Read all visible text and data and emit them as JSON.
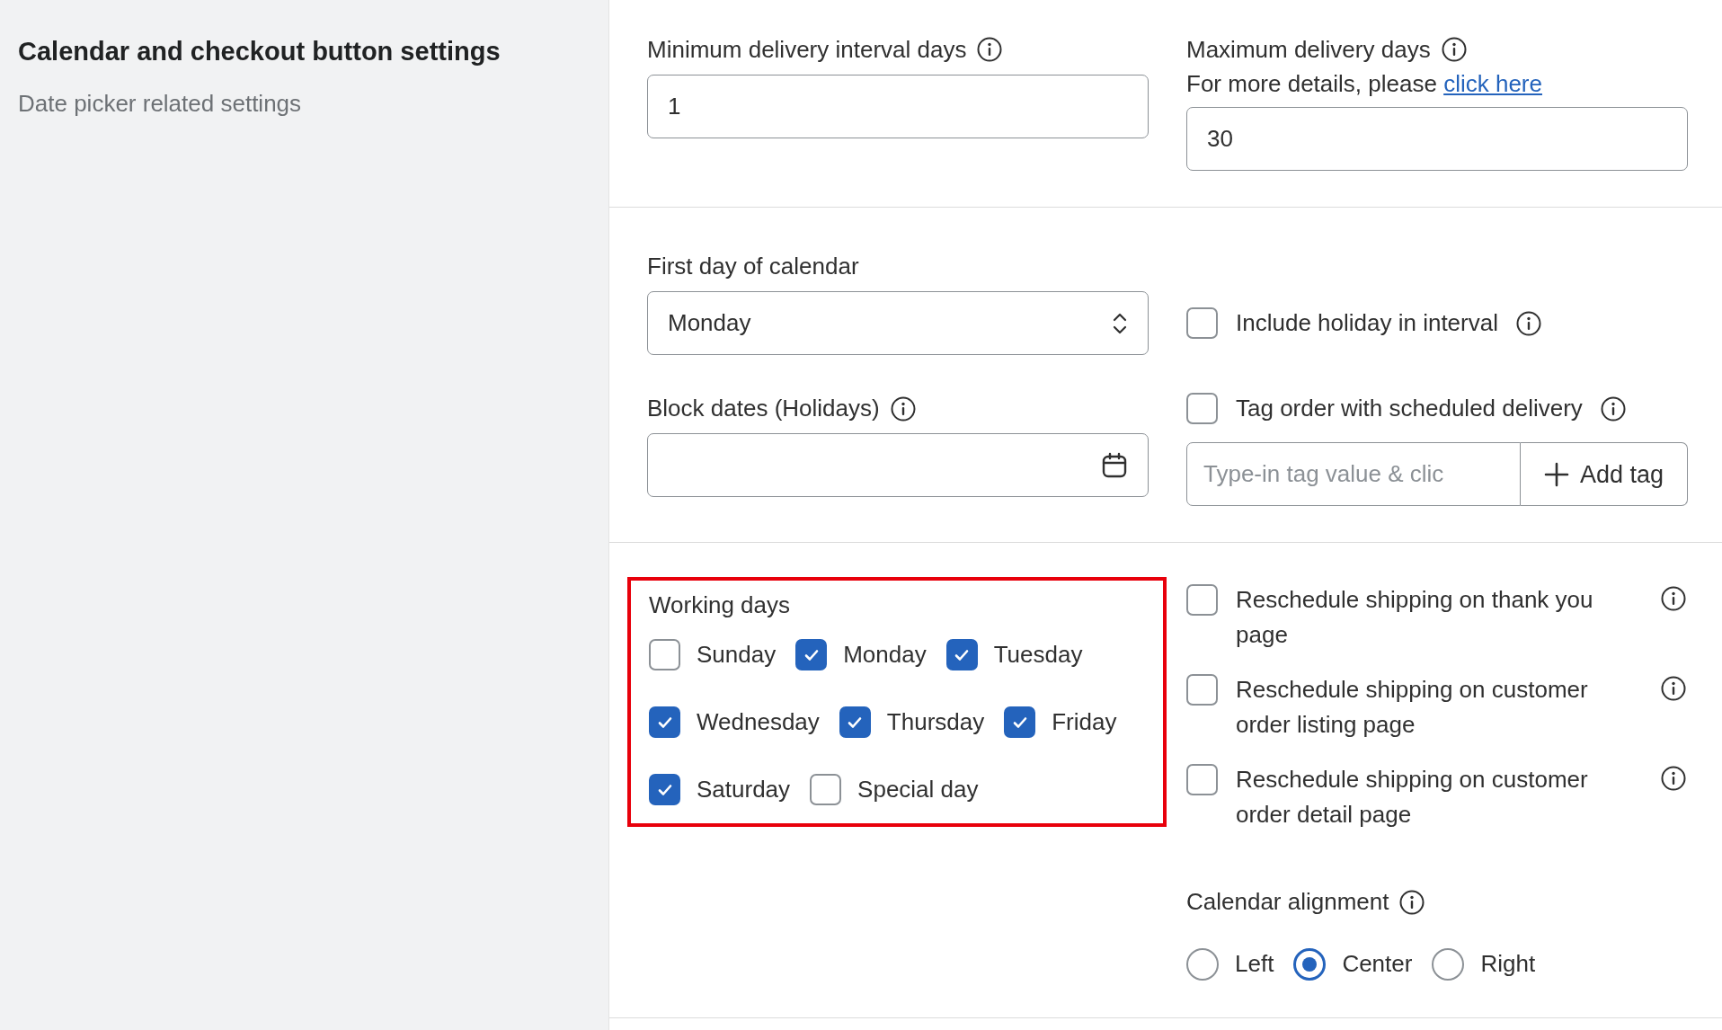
{
  "sidebar": {
    "title": "Calendar and checkout button settings",
    "subtitle": "Date picker related settings"
  },
  "delivery": {
    "min_label": "Minimum delivery interval days",
    "min_value": "1",
    "max_label": "Maximum delivery days",
    "max_note": "For more details, please",
    "max_link": "click here",
    "max_value": "30"
  },
  "calendar": {
    "first_day_label": "First day of calendar",
    "first_day_value": "Monday",
    "block_dates_label": "Block dates (Holidays)",
    "options": [
      {
        "label": "Include holiday in interval",
        "checked": false
      },
      {
        "label": "Tag order with scheduled delivery",
        "checked": false
      }
    ],
    "tag_placeholder": "Type-in tag value & clic",
    "add_tag": "Add tag"
  },
  "working_days": {
    "label": "Working days",
    "highlighted": true,
    "days": [
      {
        "label": "Sunday",
        "checked": false
      },
      {
        "label": "Monday",
        "checked": true
      },
      {
        "label": "Tuesday",
        "checked": true
      },
      {
        "label": "Wednesday",
        "checked": true
      },
      {
        "label": "Thursday",
        "checked": true
      },
      {
        "label": "Friday",
        "checked": true
      },
      {
        "label": "Saturday",
        "checked": true
      },
      {
        "label": "Special day",
        "checked": false
      }
    ]
  },
  "reschedule": [
    {
      "label": "Reschedule shipping on thank you page",
      "checked": false
    },
    {
      "label": "Reschedule shipping on customer order listing page",
      "checked": false
    },
    {
      "label": "Reschedule shipping on customer order detail page",
      "checked": false
    }
  ],
  "alignment": {
    "label": "Calendar alignment",
    "options": [
      {
        "label": "Left",
        "selected": false
      },
      {
        "label": "Center",
        "selected": true
      },
      {
        "label": "Right",
        "selected": false
      }
    ]
  }
}
